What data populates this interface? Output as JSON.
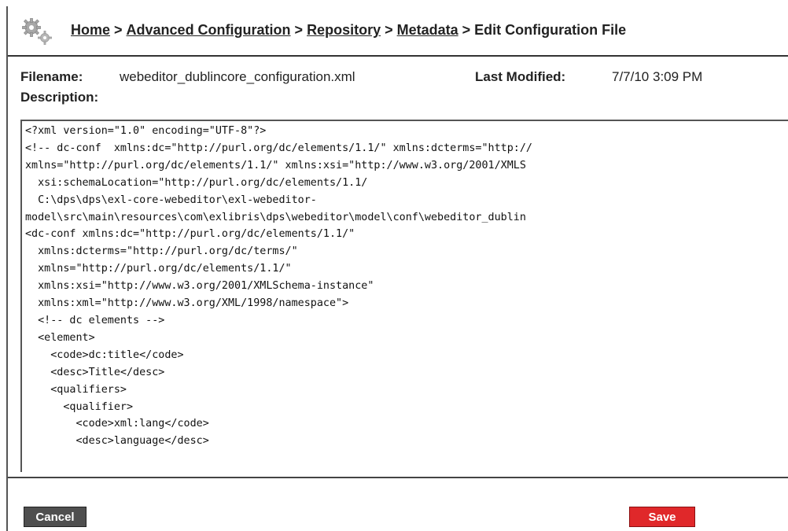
{
  "breadcrumb": {
    "items": [
      {
        "label": "Home"
      },
      {
        "label": "Advanced Configuration"
      },
      {
        "label": "Repository"
      },
      {
        "label": "Metadata"
      }
    ],
    "separator": ">",
    "current": "Edit Configuration File"
  },
  "file": {
    "filename_label": "Filename:",
    "filename_value": "webeditor_dublincore_configuration.xml",
    "last_modified_label": "Last Modified:",
    "last_modified_value": "7/7/10 3:09 PM",
    "description_label": "Description:"
  },
  "editor": {
    "content": "<?xml version=\"1.0\" encoding=\"UTF-8\"?>\n<!-- dc-conf  xmlns:dc=\"http://purl.org/dc/elements/1.1/\" xmlns:dcterms=\"http://\nxmlns=\"http://purl.org/dc/elements/1.1/\" xmlns:xsi=\"http://www.w3.org/2001/XMLS\n  xsi:schemaLocation=\"http://purl.org/dc/elements/1.1/\n  C:\\dps\\dps\\exl-core-webeditor\\exl-webeditor-\nmodel\\src\\main\\resources\\com\\exlibris\\dps\\webeditor\\model\\conf\\webeditor_dublin\n<dc-conf xmlns:dc=\"http://purl.org/dc/elements/1.1/\"\n  xmlns:dcterms=\"http://purl.org/dc/terms/\"\n  xmlns=\"http://purl.org/dc/elements/1.1/\"\n  xmlns:xsi=\"http://www.w3.org/2001/XMLSchema-instance\"\n  xmlns:xml=\"http://www.w3.org/XML/1998/namespace\">\n  <!-- dc elements -->\n  <element>\n    <code>dc:title</code>\n    <desc>Title</desc>\n    <qualifiers>\n      <qualifier>\n        <code>xml:lang</code>\n        <desc>language</desc>"
  },
  "actions": {
    "cancel_label": "Cancel",
    "save_label": "Save"
  },
  "colors": {
    "save_button": "#e0282a",
    "cancel_button": "#4f4f4f"
  },
  "icons": {
    "header": "gears-icon"
  }
}
